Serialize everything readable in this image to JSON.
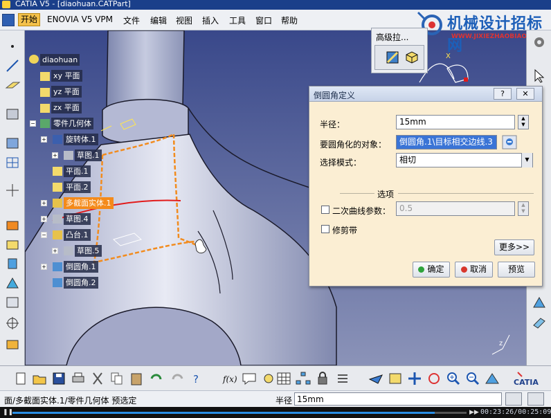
{
  "window": {
    "title": "CATIA V5 - [diaohuan.CATPart]"
  },
  "menubar": {
    "items": [
      "开始",
      "ENOVIA V5 VPM",
      "文件",
      "编辑",
      "视图",
      "插入",
      "工具",
      "窗口",
      "帮助"
    ]
  },
  "watermark": {
    "title": "机械设计招标网",
    "url": "WWW.JIXIEZHAOBIAO.COM"
  },
  "tree": {
    "root": "diaohuan",
    "nodes": [
      "xy 平面",
      "yz 平面",
      "zx 平面",
      "零件几何体",
      "旋转体.1",
      "草图.1",
      "平面.1",
      "平面.2",
      "多截面实体.1",
      "草图.4",
      "凸台.1",
      "草图.5",
      "倒圆角.1",
      "倒圆角.2"
    ]
  },
  "advanced_toolbar": {
    "title": "高级拉..."
  },
  "dialog": {
    "title": "倒圆角定义",
    "help_label": "?",
    "close_label": "✕",
    "radius_label": "半径：",
    "radius_value": "15mm",
    "objects_label": "要圆角化的对象：",
    "objects_value": "倒圆角.1\\目标相交边线.3",
    "mode_label": "选择模式：",
    "mode_value": "相切",
    "options_label": "选项",
    "conic_label": "二次曲线参数：",
    "conic_value": "0.5",
    "conic_checked": false,
    "trim_label": "修剪带",
    "trim_checked": false,
    "more_label": "更多>>",
    "ok_label": "确定",
    "cancel_label": "取消",
    "preview_label": "预览"
  },
  "statusbar": {
    "message": "面/多截面实体.1/零件几何体 预选定",
    "param_label": "半径",
    "param_value": "15mm"
  },
  "player": {
    "time": "00:23:26/00:25:09",
    "progress": 0.93
  },
  "colors": {
    "highlight": "#f48a1a",
    "viewport": "#43548f",
    "dialog_bg": "#fbeed3"
  }
}
